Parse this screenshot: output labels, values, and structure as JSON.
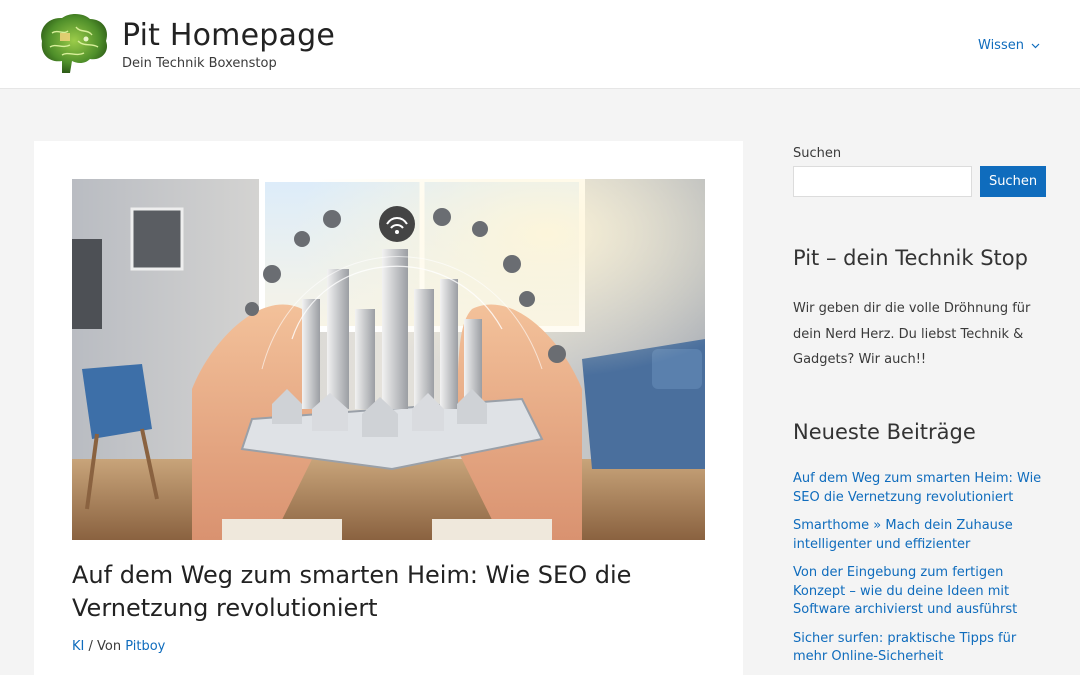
{
  "header": {
    "site_title": "Pit Homepage",
    "tagline": "Dein Technik Boxenstop",
    "nav_item": "Wissen"
  },
  "article": {
    "title": "Auf dem Weg zum smarten Heim: Wie SEO die Vernetzung revolutioniert",
    "meta_category": "KI",
    "meta_separator": " / Von ",
    "meta_author": "Pitboy"
  },
  "sidebar": {
    "search_label": "Suchen",
    "search_button": "Suchen",
    "about_title": "Pit – dein Technik Stop",
    "about_text": "Wir geben dir die volle Dröhnung für dein Nerd Herz. Du liebst Technik & Gadgets? Wir auch!!",
    "recent_title": "Neueste Beiträge",
    "recent_posts": [
      "Auf dem Weg zum smarten Heim: Wie SEO die Vernetzung revolutioniert",
      "Smarthome » Mach dein Zuhause intelligenter und effizienter",
      "Von der Eingebung zum fertigen Konzept – wie du deine Ideen mit Software archivierst und ausführst",
      "Sicher surfen: praktische Tipps für mehr Online-Sicherheit"
    ]
  },
  "colors": {
    "accent": "#0f6cbd",
    "background": "#f4f4f4"
  }
}
